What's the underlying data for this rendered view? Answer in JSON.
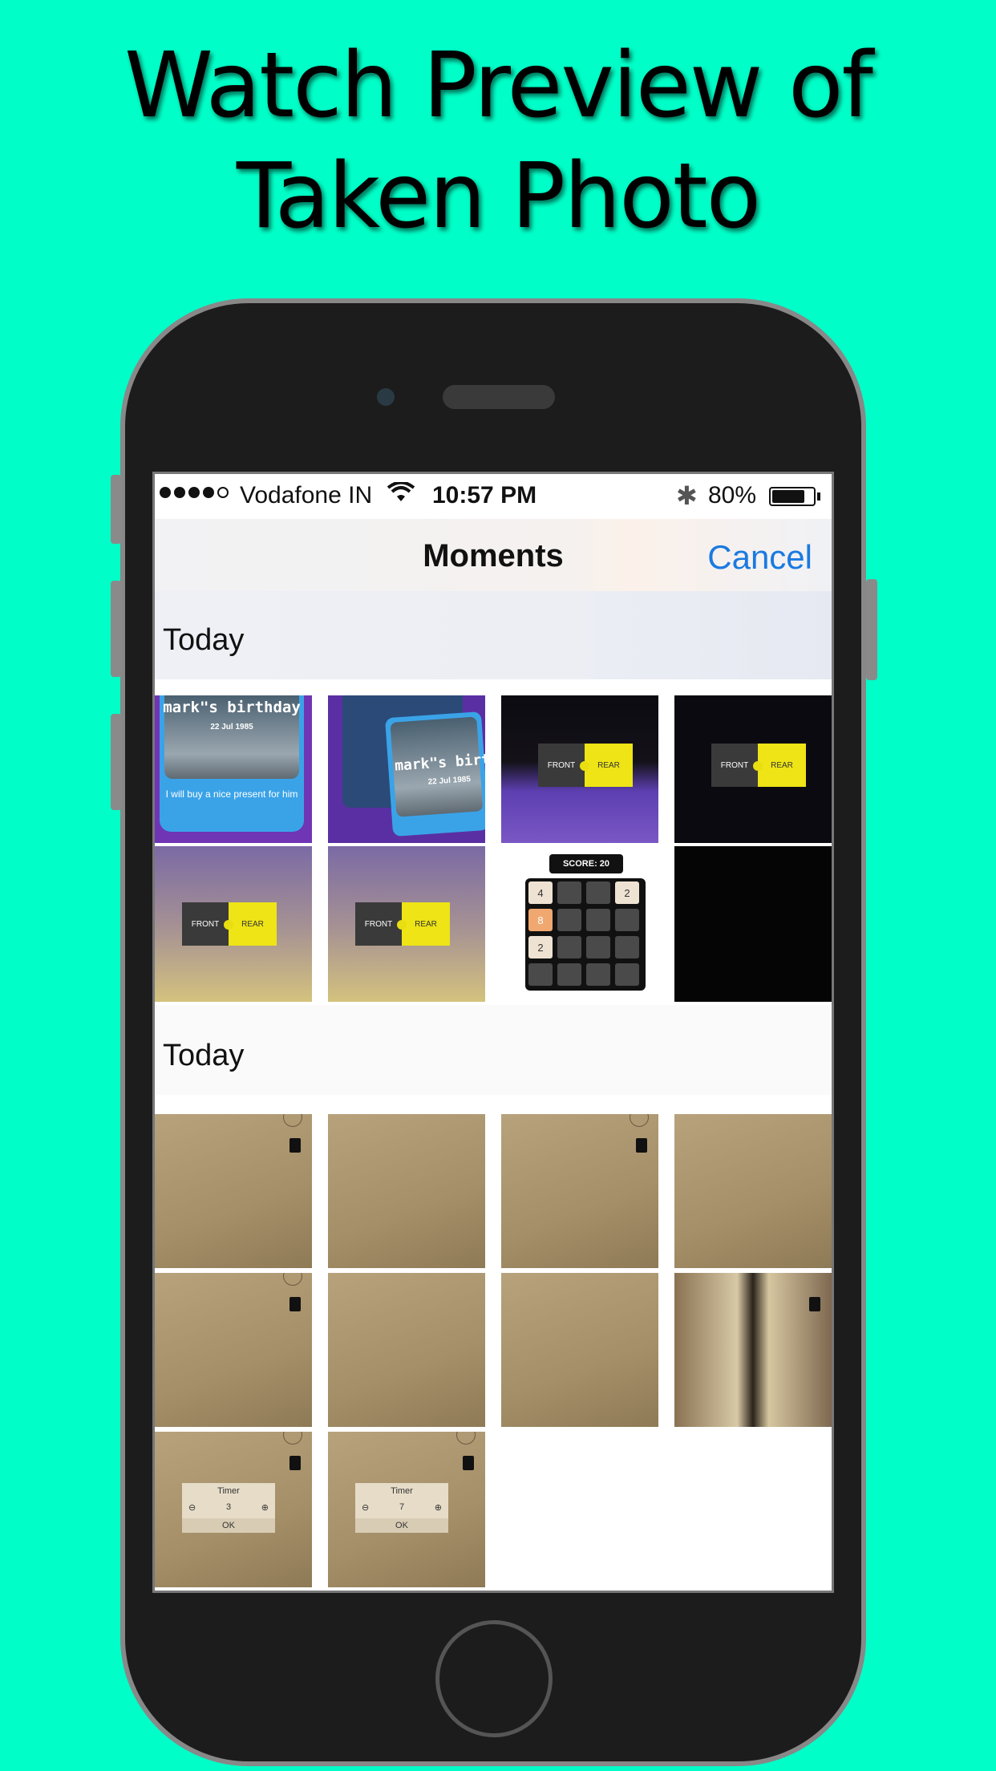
{
  "headline": {
    "line1": "Watch Preview of",
    "line2": "Taken Photo"
  },
  "status_bar": {
    "carrier": "Vodafone IN",
    "time": "10:57 PM",
    "battery": "80%",
    "battery_level": 0.8
  },
  "nav": {
    "title": "Moments",
    "cancel": "Cancel"
  },
  "sections": [
    {
      "header": "Today"
    },
    {
      "header": "Today"
    }
  ],
  "card1": {
    "title": "mark\"s birthday",
    "date": "22 Jul 1985",
    "text": "I will buy a nice present for him"
  },
  "card2": {
    "title": "mark\"s birthd",
    "date": "22 Jul 1985"
  },
  "toggle": {
    "front": "FRONT",
    "rear": "REAR"
  },
  "game": {
    "score": "SCORE: 20",
    "cells": [
      "4",
      "",
      "",
      "2",
      "8",
      "",
      "",
      "",
      "2",
      "",
      "",
      "",
      "",
      "",
      "",
      ""
    ]
  },
  "timer1": {
    "title": "Timer",
    "value": "3",
    "ok": "OK"
  },
  "timer2": {
    "title": "Timer",
    "value": "7",
    "ok": "OK"
  }
}
